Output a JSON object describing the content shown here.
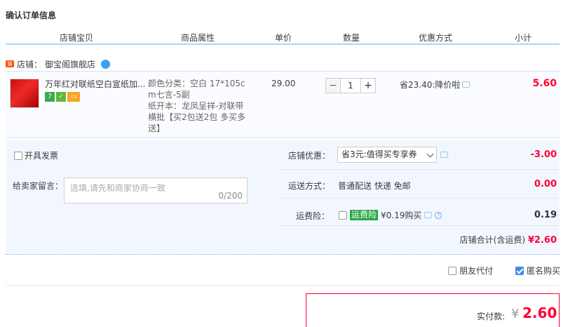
{
  "page": {
    "title": "确认订单信息"
  },
  "columns": [
    "店铺宝贝",
    "商品属性",
    "单价",
    "数量",
    "优惠方式",
    "小计"
  ],
  "shop": {
    "label": "店铺：",
    "name": "御宝阁旗舰店"
  },
  "item": {
    "title": "万年红对联纸空白宣纸加...",
    "prop1_line1": "颜色分类：空白 17*105c",
    "prop1_line2": "m七言-5副",
    "prop2_line1": "纸开本：龙凤呈祥-对联带",
    "prop2_line2": "横批【买2包送2包 多买多",
    "prop2_line3": "送】",
    "price": "29.00",
    "quantity": "1",
    "minus": "−",
    "plus": "+",
    "promo": "省23.40:降价啦",
    "subtotal": "5.60"
  },
  "options": {
    "invoice_label": "开具发票",
    "memo_label": "给卖家留言：",
    "memo_placeholder": "选填,请先和商家协商一致",
    "memo_count": "0/200",
    "shop_discount_label": "店铺优惠：",
    "shop_discount_selected": "省3元:值得买专享券",
    "shop_discount_value": "-3.00",
    "shipping_label": "运送方式：",
    "shipping_value": "普通配送 快递 免邮",
    "shipping_fee": "0.00",
    "insurance_label": "运费险：",
    "insurance_tag": "运费险",
    "insurance_price": "¥0.19购买",
    "insurance_value": "0.19",
    "shop_total_label": "店铺合计(含运费)",
    "shop_total_value": "¥2.60"
  },
  "footer": {
    "friend_pay": "朋友代付",
    "anonymous": "匿名购买",
    "pay_label": "实付款:",
    "pay_currency": "¥",
    "pay_amount": "2.60"
  },
  "colors": {
    "accent": "#ff0036",
    "link_blue": "#3d8ee8",
    "panel_bg": "#f2f7ff"
  }
}
